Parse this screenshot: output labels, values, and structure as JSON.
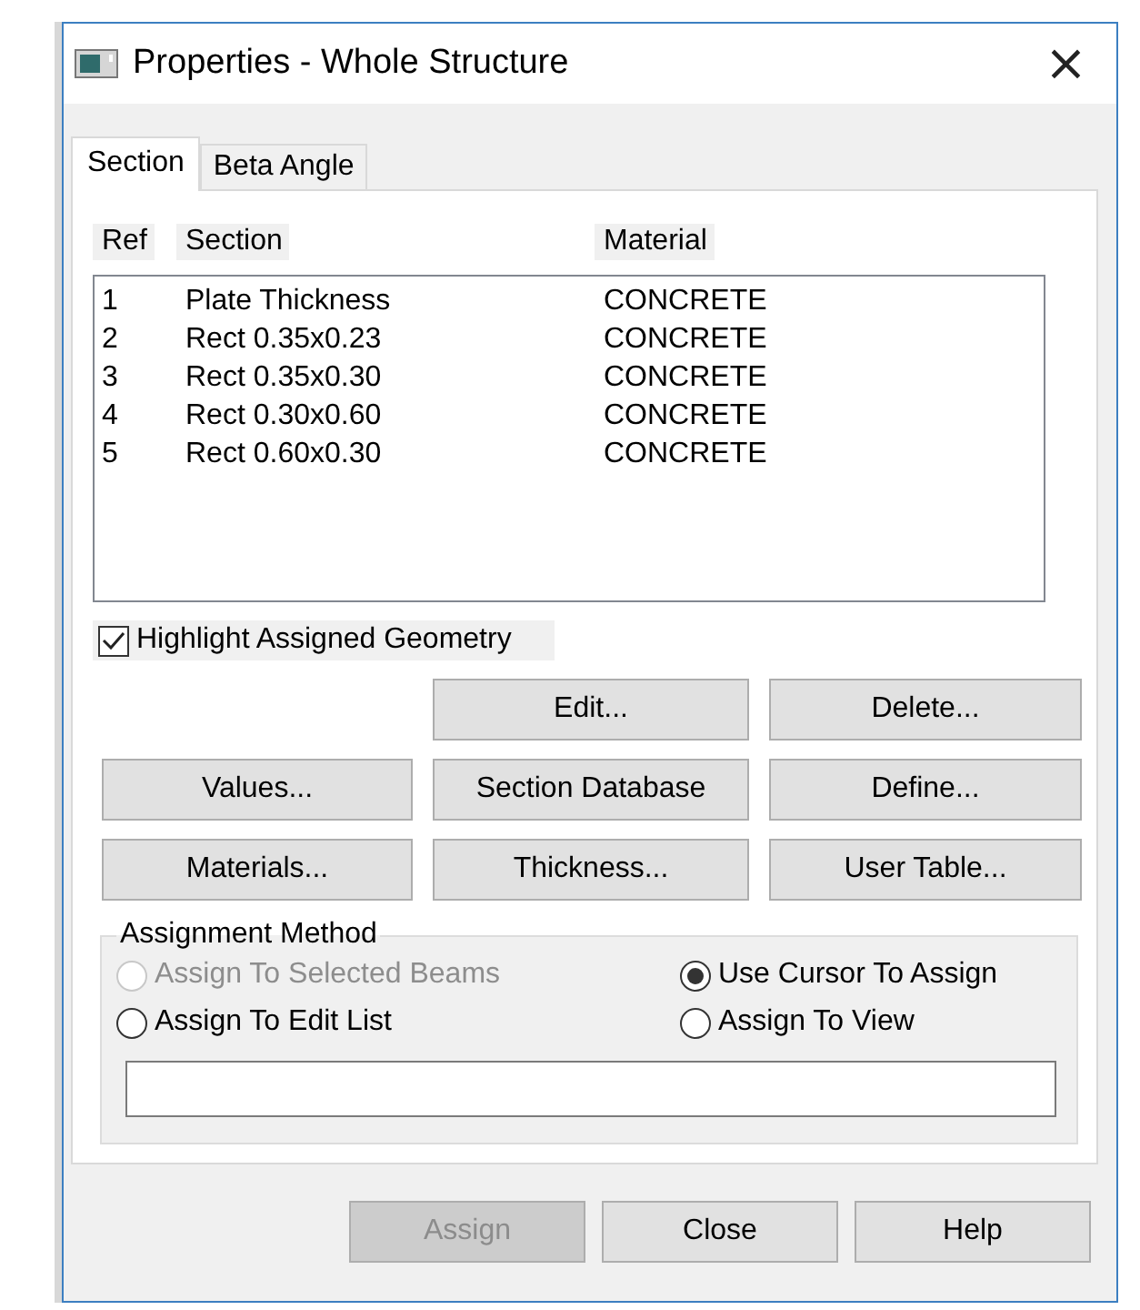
{
  "window": {
    "title": "Properties - Whole Structure",
    "close": "×"
  },
  "tabs": [
    {
      "label": "Section",
      "selected": true
    },
    {
      "label": "Beta Angle",
      "selected": false
    }
  ],
  "table": {
    "columns": [
      "Ref",
      "Section",
      "Material"
    ],
    "rows": [
      [
        "1",
        "Plate Thickness",
        "CONCRETE"
      ],
      [
        "2",
        "Rect 0.35x0.23",
        "CONCRETE"
      ],
      [
        "3",
        "Rect 0.35x0.30",
        "CONCRETE"
      ],
      [
        "4",
        "Rect 0.30x0.60",
        "CONCRETE"
      ],
      [
        "5",
        "Rect 0.60x0.30",
        "CONCRETE"
      ]
    ]
  },
  "highlight": {
    "label": "Highlight Assigned Geometry",
    "checked": true
  },
  "buttons": [
    [
      {
        "label": "Edit..."
      },
      {
        "label": "Delete..."
      }
    ],
    [
      {
        "label": "Values..."
      },
      {
        "label": "Section Database"
      },
      {
        "label": "Define..."
      }
    ],
    [
      {
        "label": "Materials..."
      },
      {
        "label": "Thickness..."
      },
      {
        "label": "User Table..."
      }
    ]
  ],
  "assignment": {
    "title": "Assignment Method",
    "options": [
      {
        "label": "Assign To Selected Beams",
        "selected": false,
        "disabled": true
      },
      {
        "label": "Use Cursor To Assign",
        "selected": true,
        "disabled": false
      },
      {
        "label": "Assign To Edit List",
        "selected": false,
        "disabled": false
      },
      {
        "label": "Assign To View",
        "selected": false,
        "disabled": false
      }
    ]
  },
  "footer": [
    {
      "label": "Assign",
      "disabled": true
    },
    {
      "label": "Close",
      "disabled": false
    },
    {
      "label": "Help",
      "disabled": false
    }
  ]
}
